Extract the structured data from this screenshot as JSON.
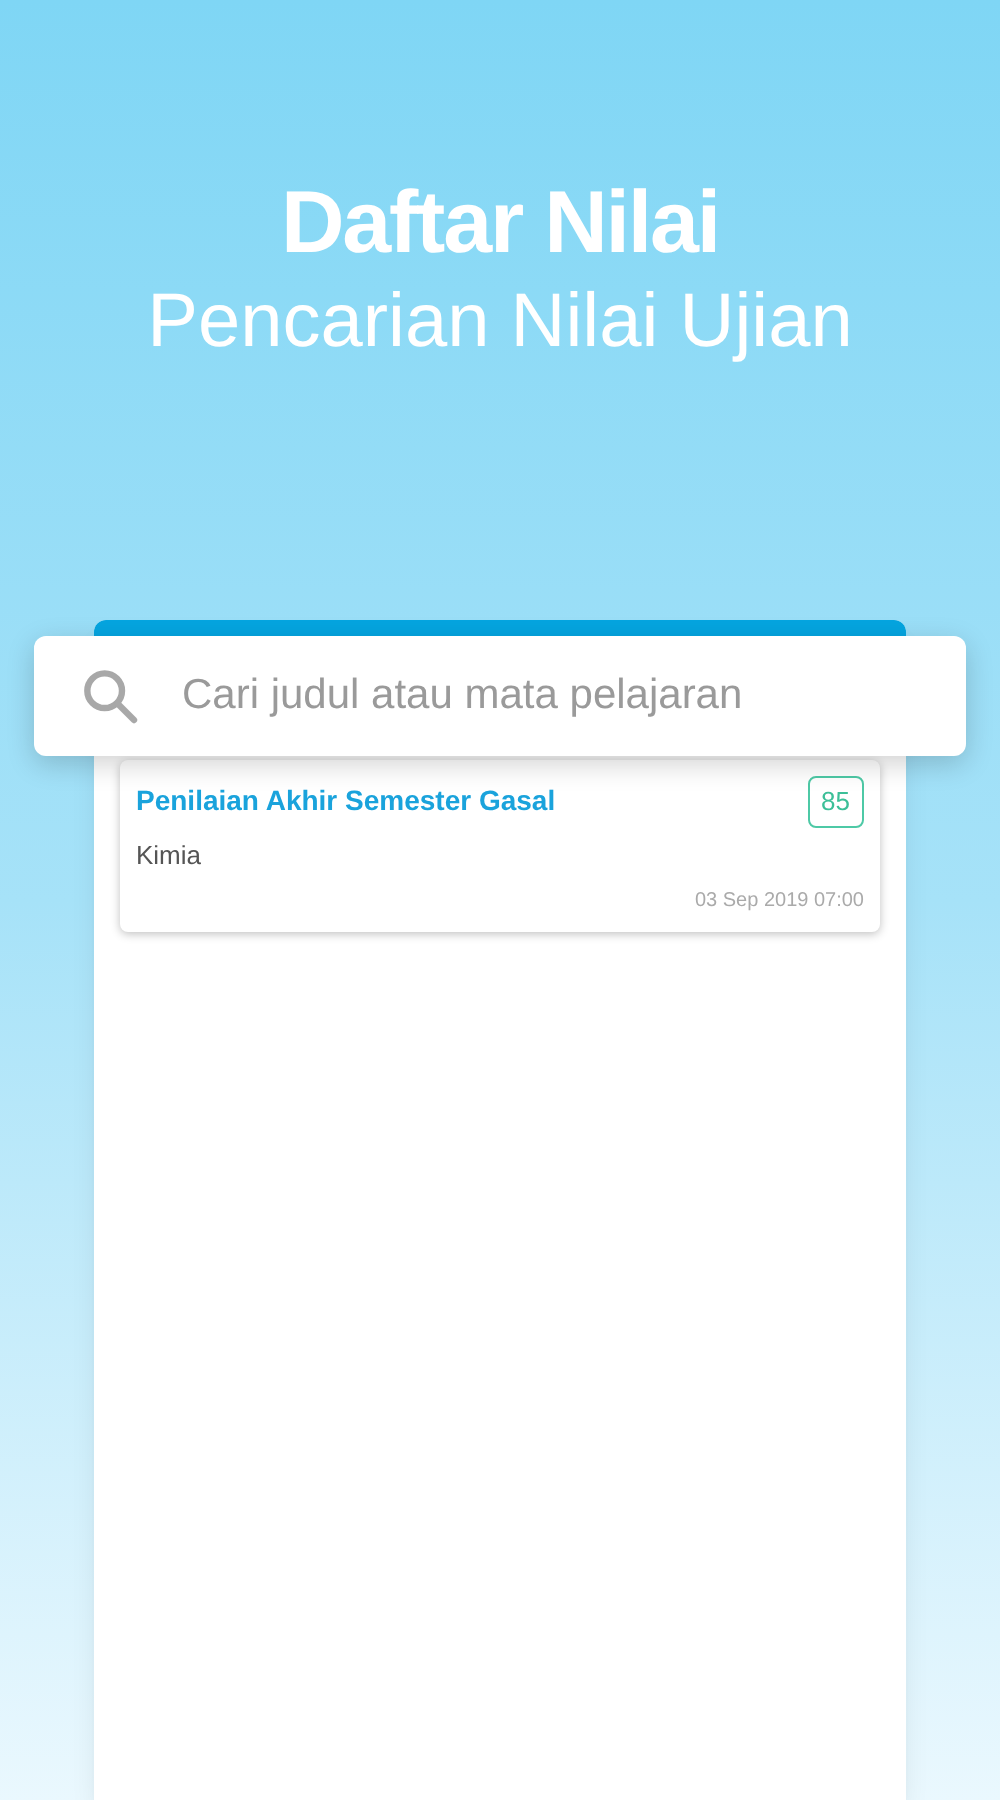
{
  "header": {
    "title": "Daftar Nilai",
    "subtitle": "Pencarian Nilai Ujian"
  },
  "search": {
    "placeholder": "Cari judul atau mata pelajaran"
  },
  "results": [
    {
      "title": "Penilaian Akhir Semester Gasal",
      "subject": "Kimia",
      "score": "85",
      "date": "03 Sep 2019 07:00"
    }
  ]
}
